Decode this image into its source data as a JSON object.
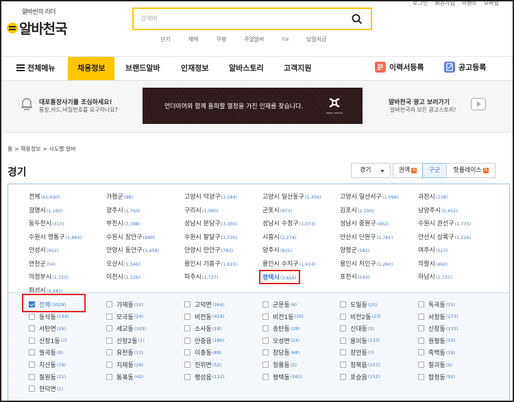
{
  "logo": {
    "tagline": "알바씬의 리더",
    "name": "알바천국"
  },
  "search": {
    "placeholder": "검색어"
  },
  "keywords": [
    "단기",
    "재택",
    "쿠팡",
    "주말알바",
    "cu",
    "당일지급"
  ],
  "util": [
    "로그인",
    "회원가입",
    "이벤트",
    "모바일"
  ],
  "gnb": {
    "menu_all": "전체메뉴",
    "items": [
      "채용정보",
      "브랜드알바",
      "인재정보",
      "알바스토리",
      "고객지원"
    ],
    "resume": "이력서등록",
    "post": "공고등록"
  },
  "banner": {
    "warn_title": "대포통장사기를 조심하세요!",
    "warn_desc": "통장,카드,비밀번호를 요구하나요?",
    "ad_text": "언더아머와 함께 돌파할 열정을 가진 인재를 찾습니다.",
    "ad_brand": "UNDER ARMOUR",
    "right_title": "알바천국 광고 보러가기",
    "right_desc": "알바천국의 모든 광고스토리!"
  },
  "breadcrumb": "홈 > 채용정보 > 사도별 알바",
  "region": {
    "title": "경기",
    "select_value": "경기"
  },
  "tabs": [
    {
      "label": "권역",
      "badge": "N"
    },
    {
      "label": "구군",
      "badge": ""
    },
    {
      "label": "핫플레이스",
      "badge": "N"
    }
  ],
  "cities": [
    {
      "name": "전체",
      "count": "(61,690)"
    },
    {
      "name": "가평군",
      "count": "(98)"
    },
    {
      "name": "고양시 덕양구",
      "count": "(1,584)"
    },
    {
      "name": "고양시 일산동구",
      "count": "(1,456)"
    },
    {
      "name": "고양시 일산서구",
      "count": "(1,098)"
    },
    {
      "name": "과천시",
      "count": "(238)"
    },
    {
      "name": "광명시",
      "count": "(1,160)"
    },
    {
      "name": "광주시",
      "count": "(1,750)"
    },
    {
      "name": "구리시",
      "count": "(1,080)"
    },
    {
      "name": "군포시",
      "count": "(973)"
    },
    {
      "name": "김포시",
      "count": "(2,190)"
    },
    {
      "name": "남양주시",
      "count": "(2,452)"
    },
    {
      "name": "동두천시",
      "count": "(313)"
    },
    {
      "name": "부천시",
      "count": "(3,798)"
    },
    {
      "name": "성남시 분당구",
      "count": "(3,305)"
    },
    {
      "name": "성남시 수정구",
      "count": "(1,073)"
    },
    {
      "name": "성남시 중원구",
      "count": "(902)"
    },
    {
      "name": "수원시 권선구",
      "count": "(1,775)"
    },
    {
      "name": "수원시 영통구",
      "count": "(1,883)"
    },
    {
      "name": "수원시 장안구",
      "count": "(990)"
    },
    {
      "name": "수원시 팔달구",
      "count": "(1,720)"
    },
    {
      "name": "시흥시",
      "count": "(2,274)"
    },
    {
      "name": "안산시 단원구",
      "count": "(1,761)"
    },
    {
      "name": "안산시 상록구",
      "count": "(1,226)"
    },
    {
      "name": "안성시",
      "count": "(952)"
    },
    {
      "name": "안양시 동안구",
      "count": "(1,458)"
    },
    {
      "name": "안양시 만안구",
      "count": "(783)"
    },
    {
      "name": "양주시",
      "count": "(825)"
    },
    {
      "name": "양평군",
      "count": "(181)"
    },
    {
      "name": "여주시",
      "count": "(527)"
    },
    {
      "name": "연천군",
      "count": "(54)"
    },
    {
      "name": "오산시",
      "count": "(1,346)"
    },
    {
      "name": "용인시 기흥구",
      "count": "(1,610)"
    },
    {
      "name": "용인시 수지구",
      "count": "(1,414)"
    },
    {
      "name": "용인시 처인구",
      "count": "(1,260)"
    },
    {
      "name": "의왕시",
      "count": "(462)"
    },
    {
      "name": "의정부시",
      "count": "(1,725)"
    },
    {
      "name": "이천시",
      "count": "(1,326)"
    },
    {
      "name": "파주시",
      "count": "(1,727)"
    },
    {
      "name": "평택시",
      "count": "(3,656)"
    },
    {
      "name": "포천시",
      "count": "(543)"
    },
    {
      "name": "하남시",
      "count": "(1,731)"
    },
    {
      "name": "화성시",
      "count": "(4,341)"
    }
  ],
  "districts": [
    {
      "name": "전체",
      "count": "(3029)"
    },
    {
      "name": "가재동",
      "count": "(10)"
    },
    {
      "name": "고덕면",
      "count": "(364)"
    },
    {
      "name": "군문동",
      "count": "(6)"
    },
    {
      "name": "도일동",
      "count": "(20)"
    },
    {
      "name": "독곡동",
      "count": "(15)"
    },
    {
      "name": "동삭동",
      "count": "(134)"
    },
    {
      "name": "모곡동",
      "count": "(24)"
    },
    {
      "name": "비전동",
      "count": "(419)"
    },
    {
      "name": "비전1동",
      "count": "(35)"
    },
    {
      "name": "비전2동",
      "count": "(23)"
    },
    {
      "name": "서정동",
      "count": "(273)"
    },
    {
      "name": "서탄면",
      "count": "(26)"
    },
    {
      "name": "세교동",
      "count": "(103)"
    },
    {
      "name": "소사동",
      "count": "(18)"
    },
    {
      "name": "송탄동",
      "count": "(29)"
    },
    {
      "name": "신대동",
      "count": "(3)"
    },
    {
      "name": "신장동",
      "count": "(133)"
    },
    {
      "name": "신장1동",
      "count": "(7)"
    },
    {
      "name": "신장2동",
      "count": "(1)"
    },
    {
      "name": "안중읍",
      "count": "(180)"
    },
    {
      "name": "오성면",
      "count": "(24)"
    },
    {
      "name": "용이동",
      "count": "(133)"
    },
    {
      "name": "원평동",
      "count": "(10)"
    },
    {
      "name": "월곡동",
      "count": "(0)"
    },
    {
      "name": "유천동",
      "count": "(13)"
    },
    {
      "name": "이충동",
      "count": "(89)"
    },
    {
      "name": "장당동",
      "count": "(68)"
    },
    {
      "name": "장안동",
      "count": "(7)"
    },
    {
      "name": "죽백동",
      "count": "(19)"
    },
    {
      "name": "지산동",
      "count": "(76)"
    },
    {
      "name": "지제동",
      "count": "(26)"
    },
    {
      "name": "진위면",
      "count": "(52)"
    },
    {
      "name": "청룡동",
      "count": "(2)"
    },
    {
      "name": "청북읍",
      "count": "(107)"
    },
    {
      "name": "칠괴동",
      "count": "(5)"
    },
    {
      "name": "칠원동",
      "count": "(21)"
    },
    {
      "name": "통복동",
      "count": "(42)"
    },
    {
      "name": "팽성읍",
      "count": "(112)"
    },
    {
      "name": "평택동",
      "count": "(161)"
    },
    {
      "name": "포승읍",
      "count": "(152)"
    },
    {
      "name": "합정동",
      "count": "(92)"
    },
    {
      "name": "현덕면",
      "count": "(1)"
    }
  ],
  "colors": {
    "accent": "#ffc600",
    "link": "#3a7bd5",
    "highlight": "#e61e1e"
  }
}
